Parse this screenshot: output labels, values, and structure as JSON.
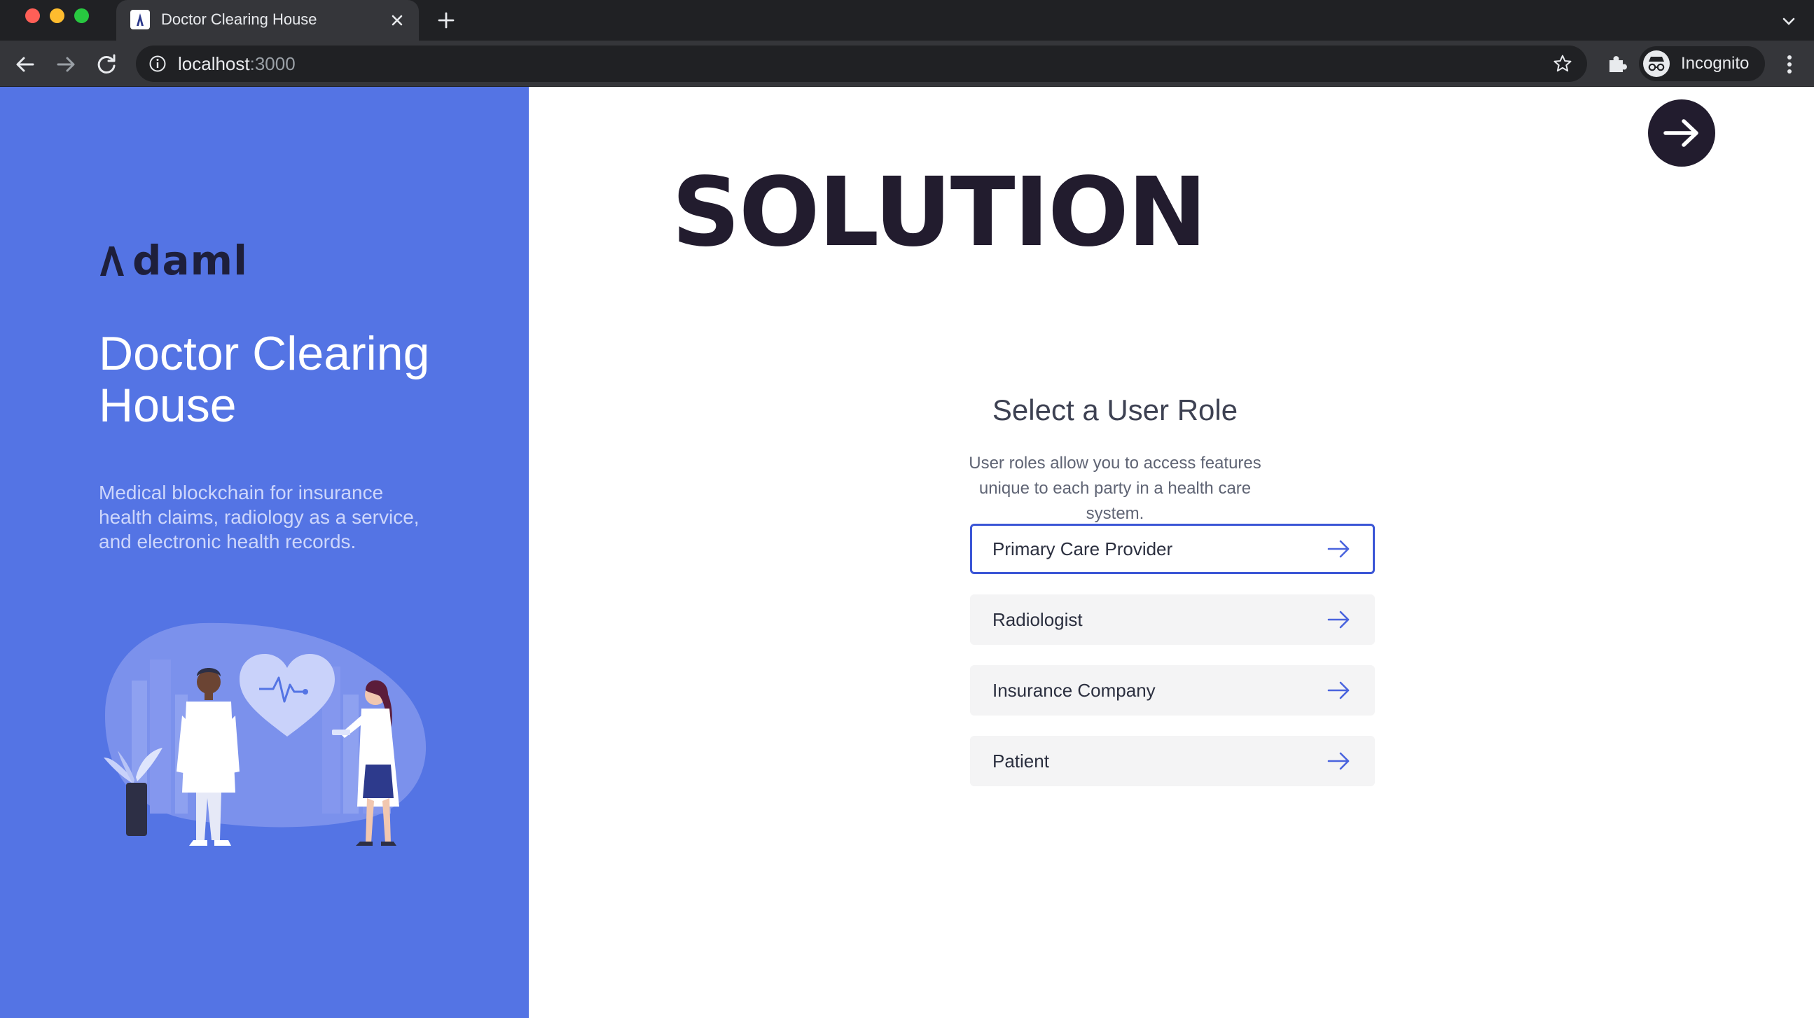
{
  "browser": {
    "tab_title": "Doctor Clearing House",
    "url_host": "localhost",
    "url_port": ":3000",
    "profile_label": "Incognito"
  },
  "sidebar": {
    "logo_text": "daml",
    "title": "Doctor Clearing House",
    "description": "Medical blockchain for insurance health claims, radiology as a service, and electronic health records."
  },
  "main": {
    "heading": "SOLUTION",
    "role_title": "Select a User Role",
    "role_description": "User roles allow you to access features unique to each party in a health care system.",
    "roles": [
      {
        "label": "Primary Care Provider",
        "selected": true
      },
      {
        "label": "Radiologist",
        "selected": false
      },
      {
        "label": "Insurance Company",
        "selected": false
      },
      {
        "label": "Patient",
        "selected": false
      }
    ]
  },
  "colors": {
    "sidebar_bg": "#5474e4",
    "dark": "#221c2e",
    "accent": "#3b56d6",
    "button_bg": "#f4f4f5"
  },
  "icons": [
    "daml-favicon",
    "close-icon",
    "plus-icon",
    "chevron-down-icon",
    "back-arrow-icon",
    "forward-arrow-icon",
    "reload-icon",
    "info-icon",
    "star-icon",
    "puzzle-icon",
    "incognito-icon",
    "kebab-menu-icon",
    "arrow-right-icon",
    "doctors-heart-illustration"
  ]
}
